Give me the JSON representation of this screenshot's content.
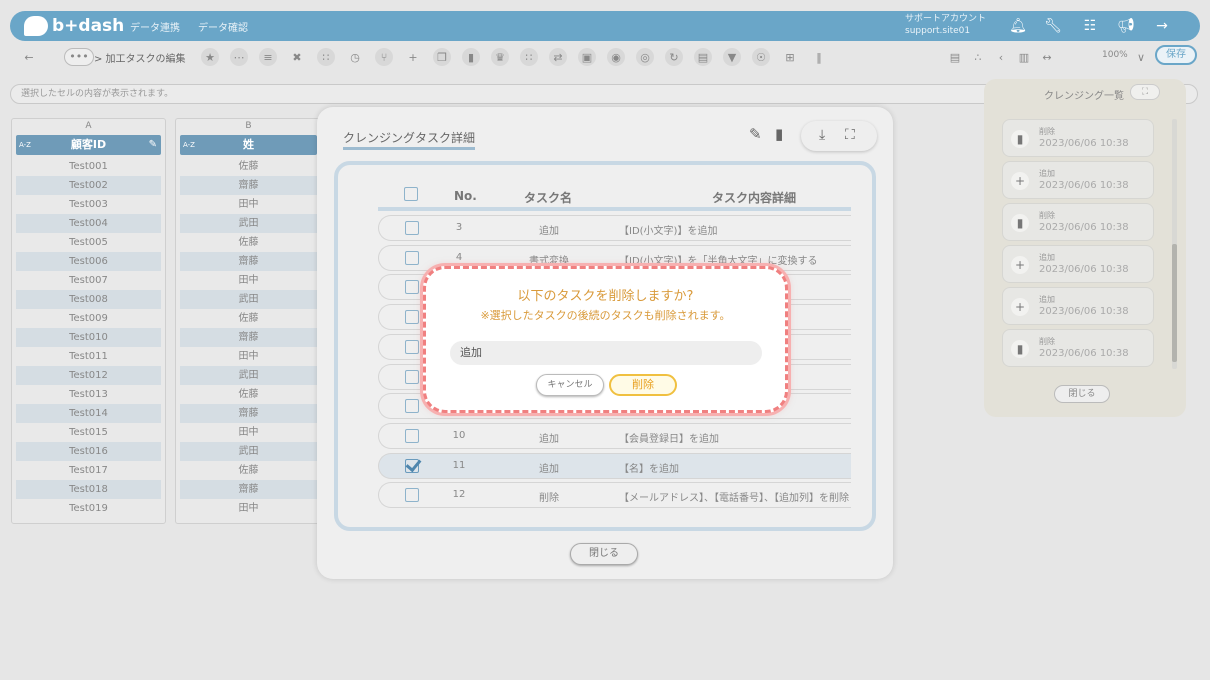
{
  "header": {
    "logo_text": "b+dash",
    "nav": [
      "データ連携",
      "データ確認"
    ],
    "account_line1": "サポートアカウント",
    "account_line2": "support.site01"
  },
  "toolbar": {
    "dots": "•••",
    "breadcrumb": "> 加工タスクの編集",
    "zoom": "100%",
    "save_label": "保存"
  },
  "selection_bar": "選択したセルの内容が表示されます。",
  "columns": [
    {
      "letter": "A",
      "key": "A-Z",
      "header": "顧客ID",
      "cells": [
        "Test001",
        "Test002",
        "Test003",
        "Test004",
        "Test005",
        "Test006",
        "Test007",
        "Test008",
        "Test009",
        "Test010",
        "Test011",
        "Test012",
        "Test013",
        "Test014",
        "Test015",
        "Test016",
        "Test017",
        "Test018",
        "Test019"
      ]
    },
    {
      "letter": "B",
      "key": "A-Z",
      "header": "姓",
      "cells": [
        "佐藤",
        "齋藤",
        "田中",
        "武田",
        "佐藤",
        "齋藤",
        "田中",
        "武田",
        "佐藤",
        "齋藤",
        "田中",
        "武田",
        "佐藤",
        "齋藤",
        "田中",
        "武田",
        "佐藤",
        "齋藤",
        "田中"
      ]
    }
  ],
  "cleansing_panel": {
    "title": "クレンジング一覧",
    "close_label": "閉じる",
    "items": [
      {
        "icon": "trash-icon",
        "action": "削除",
        "date": "2023/06/06 10:38"
      },
      {
        "icon": "plus-icon",
        "action": "追加",
        "date": "2023/06/06 10:38"
      },
      {
        "icon": "trash-icon",
        "action": "削除",
        "date": "2023/06/06 10:38"
      },
      {
        "icon": "plus-icon",
        "action": "追加",
        "date": "2023/06/06 10:38"
      },
      {
        "icon": "plus-icon",
        "action": "追加",
        "date": "2023/06/06 10:38"
      },
      {
        "icon": "trash-icon",
        "action": "削除",
        "date": "2023/06/06 10:38"
      }
    ]
  },
  "detail_modal": {
    "title": "クレンジングタスク詳細",
    "headers": {
      "no": "No.",
      "name": "タスク名",
      "detail": "タスク内容詳細"
    },
    "rows": [
      {
        "no": "3",
        "name": "追加",
        "detail": "【ID(小文字)】を追加",
        "checked": false
      },
      {
        "no": "4",
        "name": "書式変換",
        "detail": "【ID(小文字)】を「半角大文字」に変換する",
        "checked": false
      },
      {
        "no": "",
        "name": "",
        "detail": "",
        "checked": false
      },
      {
        "no": "",
        "name": "",
        "detail": "",
        "checked": false
      },
      {
        "no": "",
        "name": "",
        "detail": "",
        "checked": false
      },
      {
        "no": "",
        "name": "",
        "detail": "",
        "checked": false
      },
      {
        "no": "",
        "name": "",
        "detail": "",
        "checked": false
      },
      {
        "no": "10",
        "name": "追加",
        "detail": "【会員登録日】を追加",
        "checked": false
      },
      {
        "no": "11",
        "name": "追加",
        "detail": "【名】を追加",
        "checked": true
      },
      {
        "no": "12",
        "name": "削除",
        "detail": "【メールアドレス】、【電話番号】、【追加列】を削除",
        "checked": false
      }
    ],
    "close_label": "閉じる"
  },
  "confirm_dialog": {
    "message": "以下のタスクを削除しますか?",
    "note": "※選択したタスクの後続のタスクも削除されます。",
    "task": "追加",
    "cancel_label": "キャンセル",
    "delete_label": "削除"
  },
  "colors": {
    "accent": "#6aa6c8",
    "warning": "#f08080",
    "delete": "#f0c040"
  }
}
